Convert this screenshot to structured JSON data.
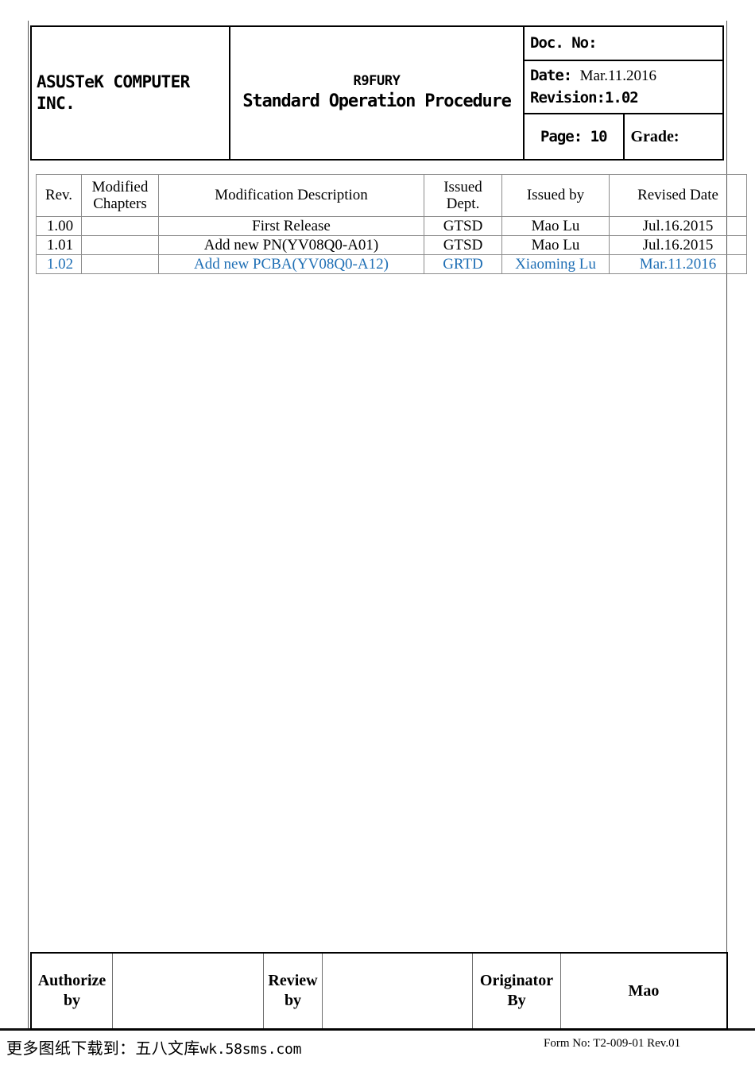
{
  "header": {
    "company": "ASUSTeK COMPUTER INC.",
    "product_title": "R9FURY",
    "document_title": "Standard Operation Procedure",
    "doc_no_label": "Doc. No:",
    "doc_no_value": "",
    "date_label": "Date:",
    "date_value": "Mar.11.2016",
    "revision_label": "Revision:",
    "revision_value": "1.02",
    "page_label": "Page:",
    "page_value": "10",
    "grade_label": "Grade:",
    "grade_value": ""
  },
  "revision_table": {
    "columns": [
      "Rev.",
      "Modified Chapters",
      "Modification Description",
      "Issued Dept.",
      "Issued by",
      "Revised Date"
    ],
    "columns_split": {
      "rev": "Rev.",
      "chapters_line1": "Modified",
      "chapters_line2": "Chapters",
      "description": "Modification Description",
      "dept_line1": "Issued",
      "dept_line2": "Dept.",
      "issued_by": "Issued by",
      "revised_date": "Revised Date"
    },
    "rows": [
      {
        "rev": "1.00",
        "chapters": "",
        "description": "First Release",
        "dept": "GTSD",
        "issued_by": "Mao Lu",
        "date": "Jul.16.2015",
        "highlight": false
      },
      {
        "rev": "1.01",
        "chapters": "",
        "description": "Add new PN(YV08Q0-A01)",
        "dept": "GTSD",
        "issued_by": "Mao Lu",
        "date": "Jul.16.2015",
        "highlight": false
      },
      {
        "rev": "1.02",
        "chapters": "",
        "description": "Add new PCBA(YV08Q0-A12)",
        "dept": "GRTD",
        "issued_by": "Xiaoming Lu",
        "date": "Mar.11.2016",
        "highlight": true
      }
    ],
    "highlight_color": "#1f6fb5"
  },
  "signature_table": {
    "authorize_label_line1": "Authorize",
    "authorize_label_line2": "by",
    "authorize_value": "",
    "review_label_line1": "Review",
    "review_label_line2": "by",
    "review_value": "",
    "originator_label_line1": "Originator",
    "originator_label_line2": "By",
    "originator_value": "Mao"
  },
  "footer": {
    "left_cjk": "更多图纸下载到：五八文库",
    "left_ascii": "wk.58sms.com",
    "right": "Form No:  T2-009-01  Rev.01"
  }
}
